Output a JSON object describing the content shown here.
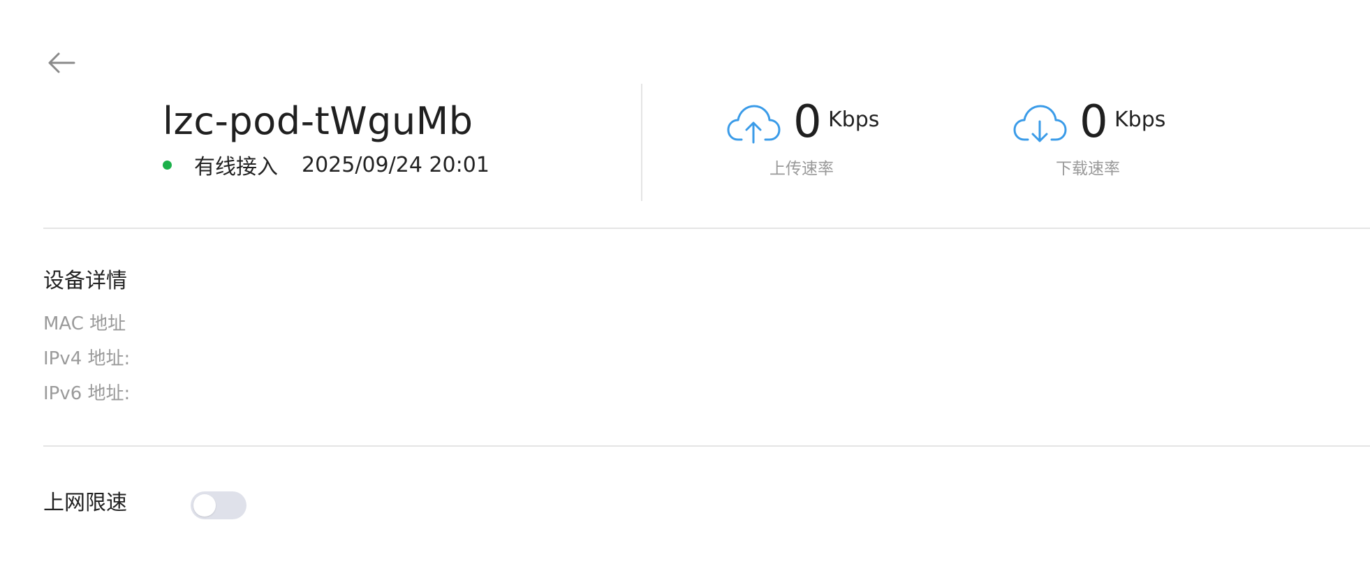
{
  "header": {
    "back_icon": "arrow-left-icon",
    "device_name": "lzc-pod-tWguMb",
    "status_color": "#1bb04a",
    "connection_type": "有线接入",
    "timestamp": "2025/09/24 20:01"
  },
  "stats": {
    "accent_color": "#3a9be8",
    "upload": {
      "icon": "cloud-upload-icon",
      "value": "0",
      "unit": "Kbps",
      "label": "上传速率"
    },
    "download": {
      "icon": "cloud-download-icon",
      "value": "0",
      "unit": "Kbps",
      "label": "下载速率"
    }
  },
  "details": {
    "title": "设备详情",
    "mac_label": "MAC 地址",
    "ipv4_label": "IPv4 地址:",
    "ipv6_label": "IPv6 地址:"
  },
  "speed_limit": {
    "label": "上网限速",
    "enabled": false
  }
}
